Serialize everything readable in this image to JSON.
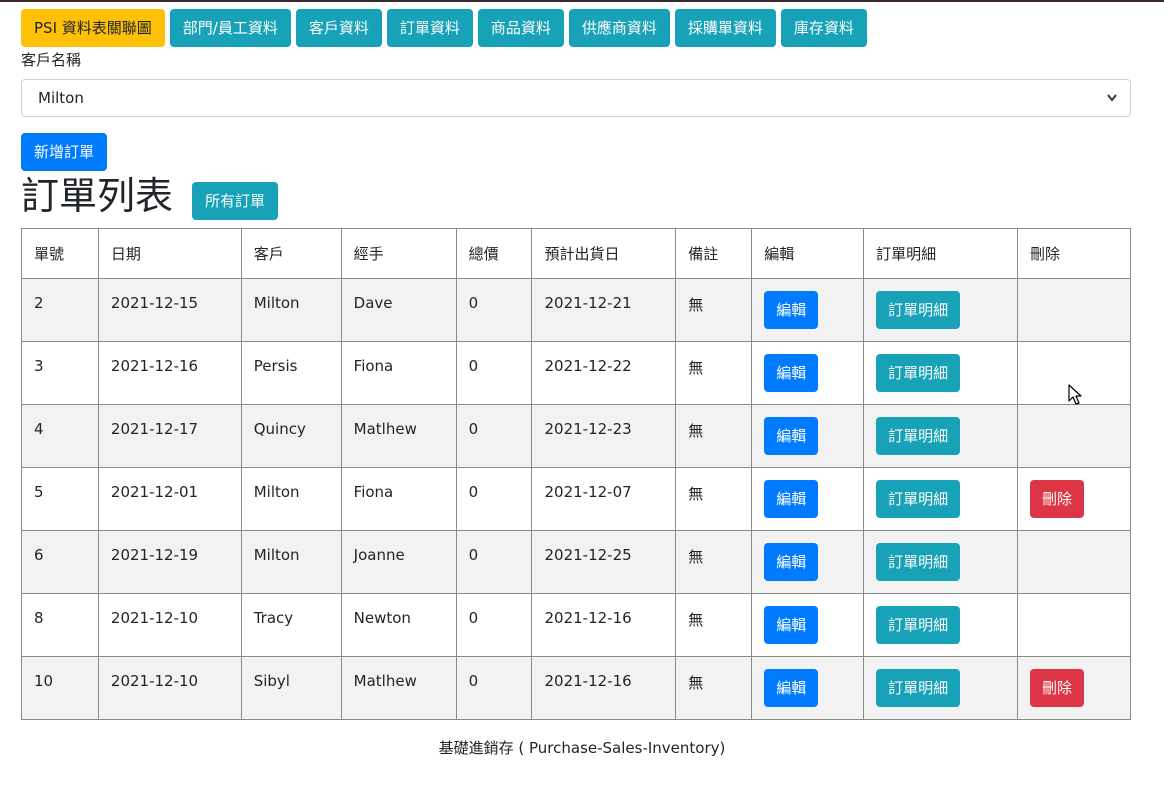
{
  "nav": [
    {
      "label": "PSI 資料表關聯圖",
      "style": "warning"
    },
    {
      "label": "部門/員工資料",
      "style": "info"
    },
    {
      "label": "客戶資料",
      "style": "info"
    },
    {
      "label": "訂單資料",
      "style": "info"
    },
    {
      "label": "商品資料",
      "style": "info"
    },
    {
      "label": "供應商資料",
      "style": "info"
    },
    {
      "label": "採購單資料",
      "style": "info"
    },
    {
      "label": "庫存資料",
      "style": "info"
    }
  ],
  "customer_filter": {
    "label": "客戶名稱",
    "selected": "Milton",
    "icon": "chevron-down-icon"
  },
  "add_order_label": "新增訂單",
  "list_title": "訂單列表",
  "all_orders_label": "所有訂單",
  "table": {
    "headers": [
      "單號",
      "日期",
      "客戶",
      "經手",
      "總價",
      "預計出貨日",
      "備註",
      "編輯",
      "訂單明細",
      "刪除"
    ],
    "rows": [
      {
        "id": "2",
        "date": "2021-12-15",
        "customer": "Milton",
        "handler": "Dave",
        "total": "0",
        "ship": "2021-12-21",
        "note": "無",
        "edit": "編輯",
        "detail": "訂單明細",
        "delete": ""
      },
      {
        "id": "3",
        "date": "2021-12-16",
        "customer": "Persis",
        "handler": "Fiona",
        "total": "0",
        "ship": "2021-12-22",
        "note": "無",
        "edit": "編輯",
        "detail": "訂單明細",
        "delete": ""
      },
      {
        "id": "4",
        "date": "2021-12-17",
        "customer": "Quincy",
        "handler": "Matlhew",
        "total": "0",
        "ship": "2021-12-23",
        "note": "無",
        "edit": "編輯",
        "detail": "訂單明細",
        "delete": ""
      },
      {
        "id": "5",
        "date": "2021-12-01",
        "customer": "Milton",
        "handler": "Fiona",
        "total": "0",
        "ship": "2021-12-07",
        "note": "無",
        "edit": "編輯",
        "detail": "訂單明細",
        "delete": "刪除"
      },
      {
        "id": "6",
        "date": "2021-12-19",
        "customer": "Milton",
        "handler": "Joanne",
        "total": "0",
        "ship": "2021-12-25",
        "note": "無",
        "edit": "編輯",
        "detail": "訂單明細",
        "delete": ""
      },
      {
        "id": "8",
        "date": "2021-12-10",
        "customer": "Tracy",
        "handler": "Newton",
        "total": "0",
        "ship": "2021-12-16",
        "note": "無",
        "edit": "編輯",
        "detail": "訂單明細",
        "delete": ""
      },
      {
        "id": "10",
        "date": "2021-12-10",
        "customer": "Sibyl",
        "handler": "Matlhew",
        "total": "0",
        "ship": "2021-12-16",
        "note": "無",
        "edit": "編輯",
        "detail": "訂單明細",
        "delete": "刪除"
      }
    ]
  },
  "footer": "基礎進銷存 ( Purchase-Sales-Inventory)",
  "colors": {
    "primary": "#007bff",
    "info": "#17a2b8",
    "warning": "#ffc107",
    "danger": "#dc3545",
    "stripe": "#f2f2f2"
  },
  "cursor_icon": "mouse-pointer-icon"
}
